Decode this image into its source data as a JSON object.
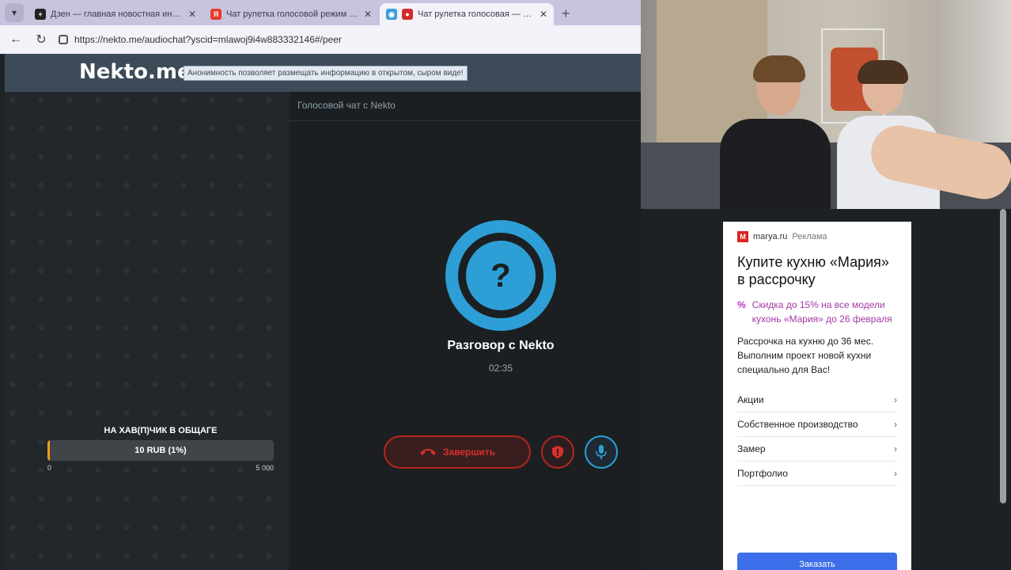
{
  "browser": {
    "tabs": [
      {
        "title": "Дзен — главная новостная инф...",
        "fav_color": "#222222",
        "fav_text": "+"
      },
      {
        "title": "Чат рулетка голосовой режим — ...",
        "fav_color": "#e63b2e",
        "fav_text": "Я"
      },
      {
        "title": "Чат рулетка голосовая — N...",
        "fav_color": "#d22b2b",
        "fav_text": "●"
      }
    ],
    "new_tab": "+",
    "url": "https://nekto.me/audiochat?yscid=mlawoj9i4w883332146#/peer"
  },
  "site": {
    "logo": "Nekto.me",
    "notice": "Анонимность позволяет размещать информацию в открытом, сыром виде!",
    "chat_title": "Голосовой чат с Nekto",
    "avatar_symbol": "?",
    "conversation_title": "Разговор с Nekto",
    "timer": "02:35",
    "end_button": "Завершить",
    "donation": {
      "title": "НА ХАВ(П)ЧИК В ОБЩАГЕ",
      "amount": "10 RUB (1%)",
      "progress_percent": 1,
      "min": "0",
      "max": "5 000"
    }
  },
  "ad": {
    "source": "marya.ru",
    "source_label": "Реклама",
    "title": "Купите кухню «Мария» в рассрочку",
    "promo": "Скидка до 15% на все модели кухонь «Мария» до 26 февраля",
    "text": "Рассрочка на кухню до 36 мес. Выполним проект новой кухни специально для Вас!",
    "items": [
      "Акции",
      "Собственное производство",
      "Замер",
      "Портфолио"
    ],
    "button": "Заказать"
  }
}
